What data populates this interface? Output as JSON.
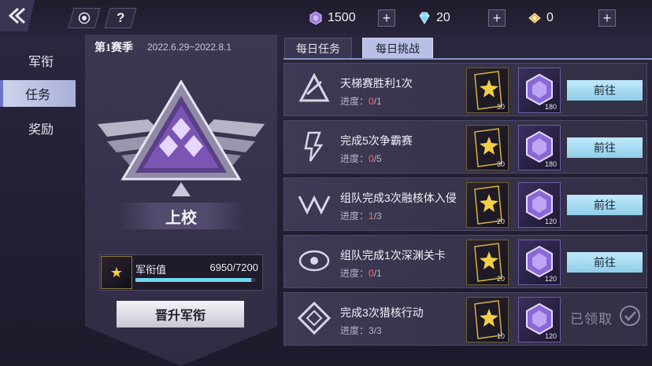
{
  "resources": [
    {
      "icon": "purple-crystal-icon",
      "value": "1500",
      "color": "#9b7be0"
    },
    {
      "icon": "blue-diamond-icon",
      "value": "20",
      "color": "#7fd6f2"
    },
    {
      "icon": "gold-gem-icon",
      "value": "0",
      "color": "#e8b44a"
    }
  ],
  "sidebar": {
    "items": [
      {
        "label": "军衔"
      },
      {
        "label": "任务"
      },
      {
        "label": "奖励"
      }
    ],
    "active_index": 1
  },
  "season": {
    "name": "第1赛季",
    "dates": "2022.6.29~2022.8.1"
  },
  "rank": {
    "name": "上校"
  },
  "exp": {
    "label": "军衔值",
    "value": "6950/7200",
    "fraction": 0.965
  },
  "promote_label": "晋升军衔",
  "tabs": [
    {
      "label": "每日任务"
    },
    {
      "label": "每日挑战"
    }
  ],
  "active_tab": 1,
  "tasks": [
    {
      "title": "天梯赛胜利1次",
      "progress_label": "进度：",
      "cur": "0",
      "total": "/1",
      "card_num": "30",
      "gem_num": "180",
      "action": "前往",
      "icon": "ladder-emblem-icon"
    },
    {
      "title": "完成5次争霸赛",
      "progress_label": "进度：",
      "cur": "0",
      "total": "/5",
      "card_num": "30",
      "gem_num": "180",
      "action": "前往",
      "icon": "tournament-emblem-icon"
    },
    {
      "title": "组队完成3次融核体入侵",
      "progress_label": "进度：",
      "cur": "1",
      "total": "/3",
      "card_num": "20",
      "gem_num": "120",
      "action": "前往",
      "icon": "invasion-emblem-icon"
    },
    {
      "title": "组队完成1次深渊关卡",
      "progress_label": "进度：",
      "cur": "0",
      "total": "/1",
      "card_num": "20",
      "gem_num": "120",
      "action": "前往",
      "icon": "abyss-eye-icon"
    },
    {
      "title": "完成3次猎核行动",
      "progress_label": "进度：",
      "cur": "3",
      "total": "/3",
      "card_num": "10",
      "gem_num": "120",
      "action": "已领取",
      "icon": "hunt-emblem-icon"
    }
  ]
}
